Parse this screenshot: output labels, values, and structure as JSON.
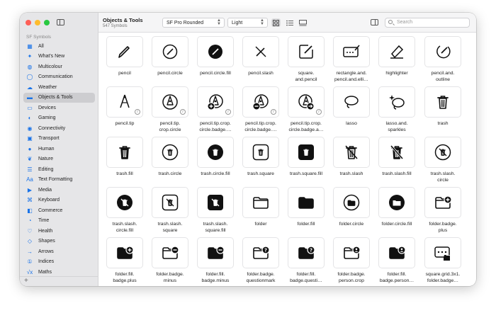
{
  "window": {
    "traffic_colors": [
      "#fe5f57",
      "#febc2e",
      "#28c840"
    ]
  },
  "sidebar": {
    "header": "SF Symbols",
    "items": [
      {
        "label": "All",
        "icon": "grid-icon",
        "glyph": "▦"
      },
      {
        "label": "What's New",
        "icon": "sparkles-icon",
        "glyph": "✦"
      },
      {
        "label": "Multicolour",
        "icon": "palette-icon",
        "glyph": "◍"
      },
      {
        "label": "Communication",
        "icon": "bubble-icon",
        "glyph": "◯"
      },
      {
        "label": "Weather",
        "icon": "cloud-icon",
        "glyph": "☁"
      },
      {
        "label": "Objects & Tools",
        "icon": "folder-icon",
        "glyph": "▬",
        "selected": true
      },
      {
        "label": "Devices",
        "icon": "display-icon",
        "glyph": "▭"
      },
      {
        "label": "Gaming",
        "icon": "gamecontroller-icon",
        "glyph": "◐"
      },
      {
        "label": "Connectivity",
        "icon": "antenna-icon",
        "glyph": "◉"
      },
      {
        "label": "Transport",
        "icon": "car-icon",
        "glyph": "▣"
      },
      {
        "label": "Human",
        "icon": "person-icon",
        "glyph": "●"
      },
      {
        "label": "Nature",
        "icon": "leaf-icon",
        "glyph": "❦"
      },
      {
        "label": "Editing",
        "icon": "slider-icon",
        "glyph": "☰"
      },
      {
        "label": "Text Formatting",
        "icon": "textformat-icon",
        "glyph": "Aa"
      },
      {
        "label": "Media",
        "icon": "media-icon",
        "glyph": "▶"
      },
      {
        "label": "Keyboard",
        "icon": "command-icon",
        "glyph": "⌘"
      },
      {
        "label": "Commerce",
        "icon": "cart-icon",
        "glyph": "◧"
      },
      {
        "label": "Time",
        "icon": "clock-icon",
        "glyph": "◔"
      },
      {
        "label": "Health",
        "icon": "heart-icon",
        "glyph": "♡"
      },
      {
        "label": "Shapes",
        "icon": "shapes-icon",
        "glyph": "◇"
      },
      {
        "label": "Arrows",
        "icon": "arrow-icon",
        "glyph": "→"
      },
      {
        "label": "Indices",
        "icon": "indices-icon",
        "glyph": "①"
      },
      {
        "label": "Maths",
        "icon": "sqrt-icon",
        "glyph": "√x"
      }
    ],
    "add_glyph": "+"
  },
  "toolbar": {
    "title": "Objects & Tools",
    "subtitle": "547 Symbols",
    "font_select": "SF Pro Rounded",
    "weight_select": "Light",
    "search_placeholder": "Search"
  },
  "symbols": [
    {
      "label": "pencil",
      "icon": "pencil"
    },
    {
      "label": "pencil.circle",
      "icon": "pencil.circle"
    },
    {
      "label": "pencil.circle.fill",
      "icon": "pencil.circle.fill"
    },
    {
      "label": "pencil.slash",
      "icon": "pencil.slash"
    },
    {
      "label": "square.\nand.pencil",
      "icon": "square.and.pencil"
    },
    {
      "label": "rectangle.and.\npencil.and.elli…",
      "icon": "rectangle.and.pencil"
    },
    {
      "label": "highlighter",
      "icon": "highlighter"
    },
    {
      "label": "pencil.and.\noutline",
      "icon": "pencil.and.outline"
    },
    {
      "label": "pencil.tip",
      "icon": "pencil.tip",
      "info": true
    },
    {
      "label": "pencil.tip.\ncrop.circle",
      "icon": "pencil.tip.crop.circle",
      "info": true
    },
    {
      "label": "pencil.tip.crop.\ncircle.badge.…",
      "icon": "pencil.tip.badge.plus",
      "info": true
    },
    {
      "label": "pencil.tip.crop.\ncircle.badge.…",
      "icon": "pencil.tip.badge.minus",
      "info": true
    },
    {
      "label": "pencil.tip.crop.\ncircle.badge.a…",
      "icon": "pencil.tip.badge.arrow",
      "info": true
    },
    {
      "label": "lasso",
      "icon": "lasso"
    },
    {
      "label": "lasso.and.\nsparkles",
      "icon": "lasso.and.sparkles"
    },
    {
      "label": "trash",
      "icon": "trash"
    },
    {
      "label": "trash.fill",
      "icon": "trash.fill"
    },
    {
      "label": "trash.circle",
      "icon": "trash.circle"
    },
    {
      "label": "trash.circle.fill",
      "icon": "trash.circle.fill"
    },
    {
      "label": "trash.square",
      "icon": "trash.square"
    },
    {
      "label": "trash.square.fill",
      "icon": "trash.square.fill"
    },
    {
      "label": "trash.slash",
      "icon": "trash.slash"
    },
    {
      "label": "trash.slash.fill",
      "icon": "trash.slash.fill"
    },
    {
      "label": "trash.slash.\ncircle",
      "icon": "trash.slash.circle"
    },
    {
      "label": "trash.slash.\ncircle.fill",
      "icon": "trash.slash.circle.fill"
    },
    {
      "label": "trash.slash.\nsquare",
      "icon": "trash.slash.square"
    },
    {
      "label": "trash.slash.\nsquare.fill",
      "icon": "trash.slash.square.fill"
    },
    {
      "label": "folder",
      "icon": "folder"
    },
    {
      "label": "folder.fill",
      "icon": "folder.fill"
    },
    {
      "label": "folder.circle",
      "icon": "folder.circle"
    },
    {
      "label": "folder.circle.fill",
      "icon": "folder.circle.fill"
    },
    {
      "label": "folder.badge.\nplus",
      "icon": "folder.badge.plus"
    },
    {
      "label": "folder.fill.\nbadge.plus",
      "icon": "folder.fill.badge.plus"
    },
    {
      "label": "folder.badge.\nminus",
      "icon": "folder.badge.minus"
    },
    {
      "label": "folder.fill.\nbadge.minus",
      "icon": "folder.fill.badge.minus"
    },
    {
      "label": "folder.badge.\nquestionmark",
      "icon": "folder.badge.questionmark"
    },
    {
      "label": "folder.fill.\nbadge.questi…",
      "icon": "folder.fill.badge.questionmark"
    },
    {
      "label": "folder.badge.\nperson.crop",
      "icon": "folder.badge.person"
    },
    {
      "label": "folder.fill.\nbadge.person…",
      "icon": "folder.fill.badge.person"
    },
    {
      "label": "square.grid.3x1.\nfolder.badge…",
      "icon": "square.grid.folder"
    }
  ],
  "info_glyph": "i"
}
